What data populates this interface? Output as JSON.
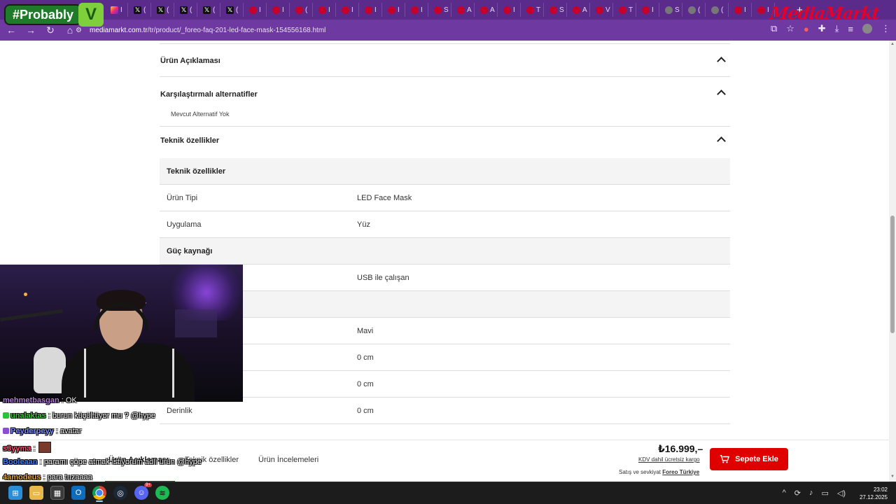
{
  "browser": {
    "url_domain": "mediamarkt.com.tr",
    "url_path": "/tr/product/_foreo-faq-201-led-face-mask-154556168.html",
    "tabs": [
      {
        "icon": "instagram-icon",
        "text": "I"
      },
      {
        "icon": "x-icon",
        "text": "("
      },
      {
        "icon": "x-icon",
        "text": "("
      },
      {
        "icon": "x-icon",
        "text": "("
      },
      {
        "icon": "x-icon",
        "text": "("
      },
      {
        "icon": "x-icon",
        "text": "("
      },
      {
        "icon": "mediamarkt-icon",
        "text": "I"
      },
      {
        "icon": "mediamarkt-icon",
        "text": "I"
      },
      {
        "icon": "mediamarkt-icon",
        "text": "("
      },
      {
        "icon": "mediamarkt-icon",
        "text": "I"
      },
      {
        "icon": "mediamarkt-icon",
        "text": "I"
      },
      {
        "icon": "mediamarkt-icon",
        "text": "I"
      },
      {
        "icon": "mediamarkt-icon",
        "text": "I"
      },
      {
        "icon": "mediamarkt-icon",
        "text": "I"
      },
      {
        "icon": "mediamarkt-icon",
        "text": "S"
      },
      {
        "icon": "mediamarkt-icon",
        "text": "A"
      },
      {
        "icon": "mediamarkt-icon",
        "text": "A"
      },
      {
        "icon": "mediamarkt-icon",
        "text": "I"
      },
      {
        "icon": "mediamarkt-icon",
        "text": "T"
      },
      {
        "icon": "mediamarkt-icon",
        "text": "S"
      },
      {
        "icon": "mediamarkt-icon",
        "text": "A"
      },
      {
        "icon": "mediamarkt-icon",
        "text": "V"
      },
      {
        "icon": "mediamarkt-icon",
        "text": "T"
      },
      {
        "icon": "mediamarkt-icon",
        "text": "I"
      },
      {
        "icon": "github-icon",
        "text": "S"
      },
      {
        "icon": "github-icon",
        "text": "("
      },
      {
        "icon": "github-icon",
        "text": "("
      },
      {
        "icon": "mediamarkt-icon",
        "text": "I"
      },
      {
        "icon": "mediamarkt-icon",
        "text": "I"
      }
    ],
    "new_tab": "+",
    "logo_text": "MediaMarkt"
  },
  "overlay": {
    "probably_text": "#Probably"
  },
  "accordions": [
    {
      "title": "Ürün Açıklaması"
    },
    {
      "title": "Karşılaştırmalı alternatifler",
      "note": "Mevcut Alternatif Yok"
    },
    {
      "title": "Teknik özellikler"
    }
  ],
  "spec_table": [
    {
      "key": "Teknik özellikler",
      "value": "",
      "head": true
    },
    {
      "key": "Ürün Tipi",
      "value": "LED Face Mask",
      "head": false
    },
    {
      "key": "Uygulama",
      "value": "Yüz",
      "head": false
    },
    {
      "key": "Güç kaynağı",
      "value": "",
      "head": true
    },
    {
      "key": "",
      "value": "USB ile çalışan",
      "head": false
    },
    {
      "key": "",
      "value": "",
      "head": true
    },
    {
      "key": "",
      "value": "Mavi",
      "head": false
    },
    {
      "key": "",
      "value": "0 cm",
      "head": false
    },
    {
      "key": "",
      "value": "0 cm",
      "head": false
    },
    {
      "key": "Derinlik",
      "value": "0 cm",
      "head": false
    }
  ],
  "sticky_bar": {
    "tabs": [
      "Ürün Açıklaması",
      "Teknik özellikler",
      "Ürün İncelemeleri"
    ],
    "price": "₺16.999,–",
    "kdv_note": "KDV dahil ücretsiz kargo",
    "seller_prefix": "Satış ve sevkiyat",
    "seller_name": "Foreo Türkiye",
    "cart_label": "Sepete Ekle"
  },
  "chat": [
    {
      "user": "mehmetbasgan",
      "color": "#b07ad6",
      "msg": ": OK"
    },
    {
      "user": "unalaktas",
      "color": "#37c43c",
      "msg": ": burun küçültüyor mu ? @hype"
    },
    {
      "user": "Peyderpeyy",
      "color": "#7a8cff",
      "msg": ": avatar"
    },
    {
      "user": "s3yyma",
      "color": "#ff4d6d",
      "msg": ":"
    },
    {
      "user": "Booleaan",
      "color": "#3f7bff",
      "msg": ": paramı çöpe atmak istiyorum adlı ürün @hype"
    },
    {
      "user": "4amodeus",
      "color": "#e0a23a",
      "msg": ": para tuzaaaa"
    }
  ],
  "taskbar": {
    "time": "23:02",
    "date": "27.12.2025",
    "discord_badge": "9+"
  }
}
